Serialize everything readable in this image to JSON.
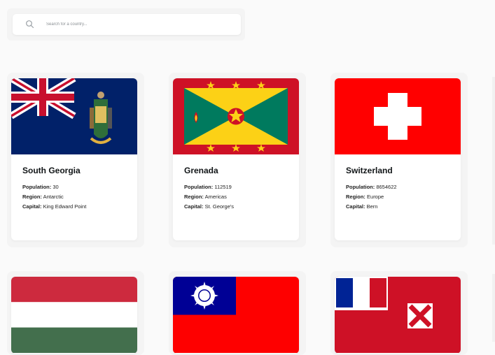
{
  "search": {
    "placeholder": "Search for a country..."
  },
  "labels": {
    "population": "Population:",
    "region": "Region:",
    "capital": "Capital:"
  },
  "countries": [
    {
      "name": "South Georgia",
      "population": "30",
      "region": "Antarctic",
      "capital": "King Edward Point"
    },
    {
      "name": "Grenada",
      "population": "112519",
      "region": "Americas",
      "capital": "St. George's"
    },
    {
      "name": "Switzerland",
      "population": "8654622",
      "region": "Europe",
      "capital": "Bern"
    }
  ],
  "colors": {
    "background": "#fafafa",
    "card": "#ffffff",
    "text": "#111517"
  }
}
